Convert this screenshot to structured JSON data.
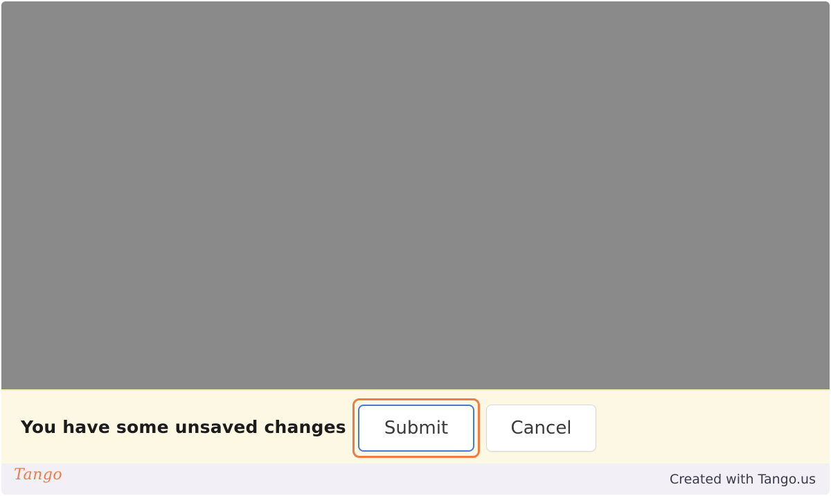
{
  "unsaved_bar": {
    "message": "You have some unsaved changes",
    "submit_label": "Submit",
    "cancel_label": "Cancel"
  },
  "footer": {
    "logo_text": "Tango",
    "credit_text": "Created with Tango.us"
  },
  "colors": {
    "overlay": "#8a8a8a",
    "bar_background": "#fdf8e3",
    "highlight": "#f07b43",
    "submit_border": "#4a78d6",
    "footer_background": "#f2f0f6"
  }
}
